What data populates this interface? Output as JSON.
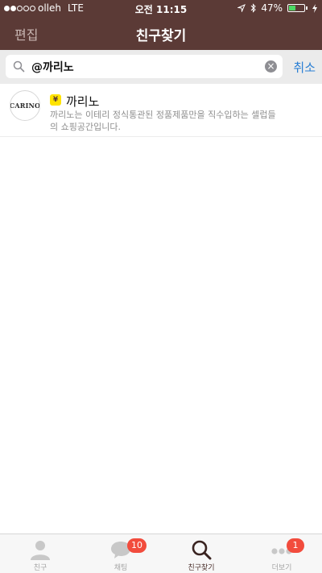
{
  "status_bar": {
    "carrier": "olleh",
    "network": "LTE",
    "time": "오전 11:15",
    "battery": "47%",
    "battery_level": 0.47
  },
  "nav": {
    "edit": "편집",
    "title": "친구찾기"
  },
  "search": {
    "value": "@까리노",
    "cancel": "취소"
  },
  "result": {
    "avatar_text": "CARINO",
    "badge": "¥",
    "name": "까리노",
    "description": "까리노는 이테리 정식통관된 정품제품만을 직수입하는 셀럽들의 쇼핑공간입니다."
  },
  "tabs": [
    {
      "label": "친구",
      "icon": "person-icon"
    },
    {
      "label": "채팅",
      "icon": "chat-bubble-icon",
      "badge": "10"
    },
    {
      "label": "친구찾기",
      "icon": "search-icon",
      "active": true
    },
    {
      "label": "더보기",
      "icon": "more-dots-icon",
      "badge": "1"
    }
  ],
  "colors": {
    "header": "#5b3a36",
    "accent_blue": "#2a7fd4",
    "badge_red": "#f24c3d",
    "plus_yellow": "#ffe300"
  }
}
